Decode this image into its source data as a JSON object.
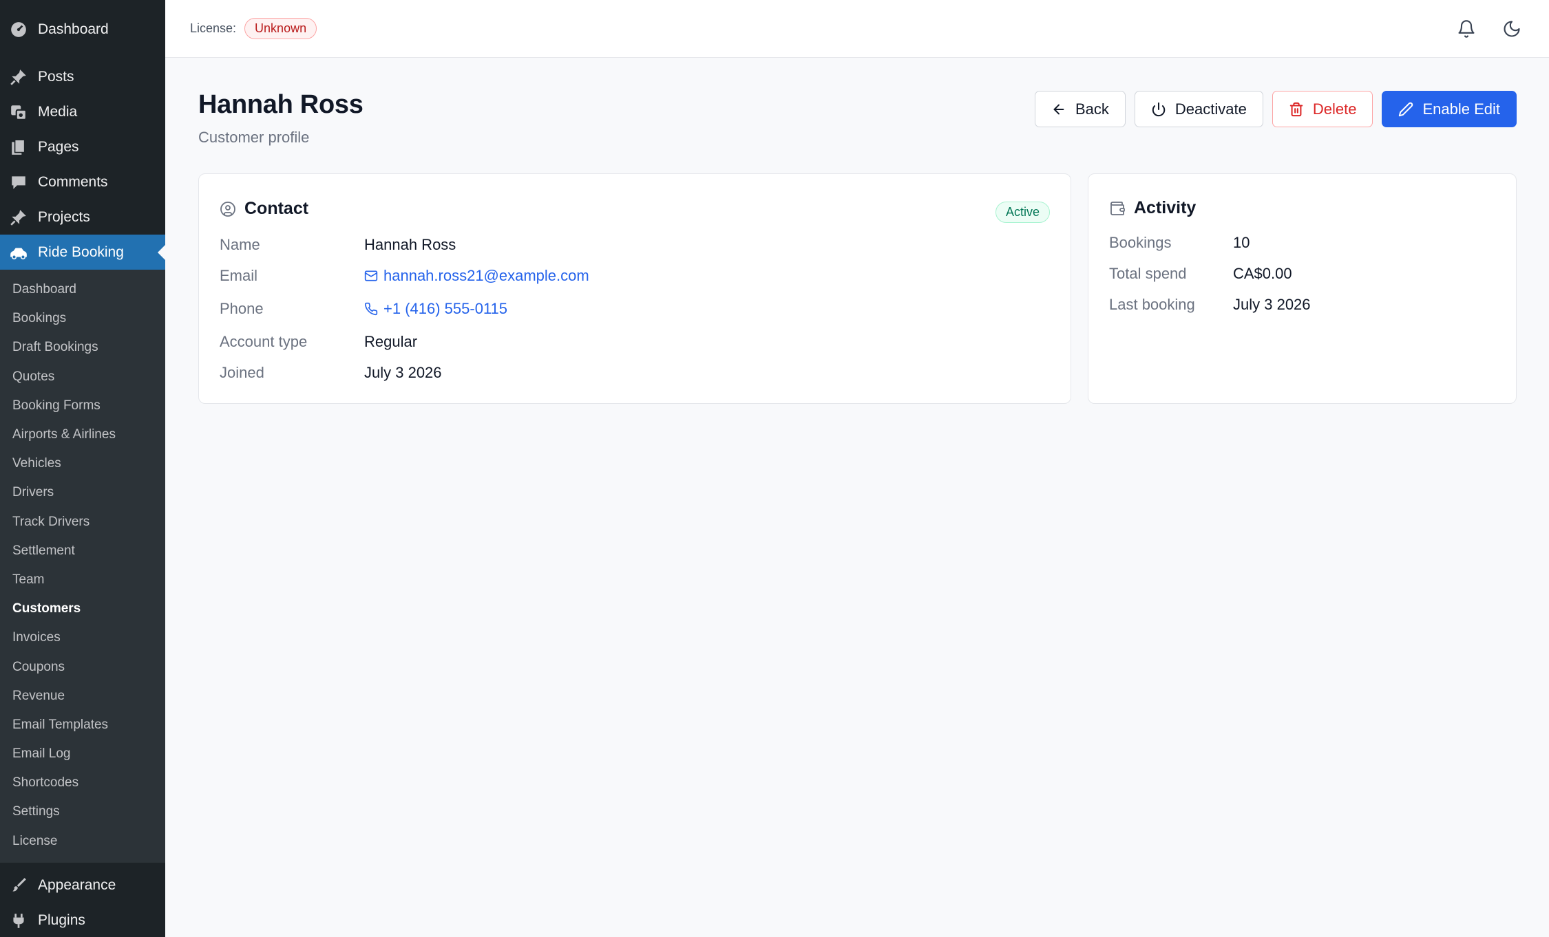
{
  "sidebar": {
    "top_items": [
      {
        "label": "Dashboard",
        "icon": "dashboard-icon"
      },
      {
        "label": "Posts",
        "icon": "pin-icon"
      },
      {
        "label": "Media",
        "icon": "media-icon"
      },
      {
        "label": "Pages",
        "icon": "pages-icon"
      },
      {
        "label": "Comments",
        "icon": "comment-icon"
      },
      {
        "label": "Projects",
        "icon": "pin-icon"
      },
      {
        "label": "Ride Booking",
        "icon": "car-icon",
        "active": true
      }
    ],
    "sub_items": [
      "Dashboard",
      "Bookings",
      "Draft Bookings",
      "Quotes",
      "Booking Forms",
      "Airports & Airlines",
      "Vehicles",
      "Drivers",
      "Track Drivers",
      "Settlement",
      "Team",
      "Customers",
      "Invoices",
      "Coupons",
      "Revenue",
      "Email Templates",
      "Email Log",
      "Shortcodes",
      "Settings",
      "License"
    ],
    "current_sub_item": "Customers",
    "bottom_items": [
      {
        "label": "Appearance",
        "icon": "brush-icon"
      },
      {
        "label": "Plugins",
        "icon": "plug-icon"
      }
    ]
  },
  "topbar": {
    "license_label": "License:",
    "license_status": "Unknown",
    "icons": [
      "bell-icon",
      "moon-icon"
    ]
  },
  "header": {
    "title": "Hannah Ross",
    "subtitle": "Customer profile"
  },
  "actions": {
    "back": "Back",
    "deactivate": "Deactivate",
    "delete": "Delete",
    "enable_edit": "Enable Edit"
  },
  "contact": {
    "title": "Contact",
    "status": "Active",
    "fields": {
      "name": {
        "label": "Name",
        "value": "Hannah Ross"
      },
      "email": {
        "label": "Email",
        "value": "hannah.ross21@example.com"
      },
      "phone": {
        "label": "Phone",
        "value": "+1 (416) 555-0115"
      },
      "account_type": {
        "label": "Account type",
        "value": "Regular"
      },
      "joined": {
        "label": "Joined",
        "value": "July 3 2026"
      }
    }
  },
  "activity": {
    "title": "Activity",
    "fields": {
      "bookings": {
        "label": "Bookings",
        "value": "10"
      },
      "total_spend": {
        "label": "Total spend",
        "value": "CA$0.00"
      },
      "last_booking": {
        "label": "Last booking",
        "value": "July 3 2026"
      }
    }
  },
  "colors": {
    "sidebar_bg": "#1d2327",
    "sidebar_active": "#2271b1",
    "primary": "#2563eb",
    "danger": "#dc2626",
    "success": "#047857"
  }
}
